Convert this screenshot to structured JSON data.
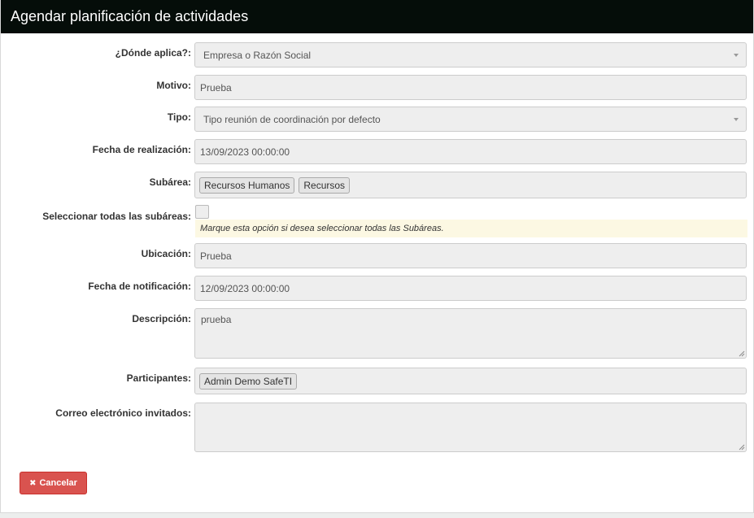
{
  "modal": {
    "title": "Agendar planificación de actividades"
  },
  "form": {
    "donde_aplica": {
      "label": "¿Dónde aplica?:",
      "value": "Empresa o Razón Social"
    },
    "motivo": {
      "label": "Motivo:",
      "value": "Prueba"
    },
    "tipo": {
      "label": "Tipo:",
      "value": "Tipo reunión de coordinación por defecto"
    },
    "fecha_realizacion": {
      "label": "Fecha de realización:",
      "value": "13/09/2023 00:00:00"
    },
    "subarea": {
      "label": "Subárea:",
      "tags": [
        "Recursos Humanos",
        "Recursos"
      ]
    },
    "seleccionar_todas": {
      "label": "Seleccionar todas las subáreas:",
      "help": "Marque esta opción si desea seleccionar todas las Subáreas.",
      "checked": false
    },
    "ubicacion": {
      "label": "Ubicación:",
      "value": "Prueba"
    },
    "fecha_notificacion": {
      "label": "Fecha de notificación:",
      "value": "12/09/2023 00:00:00"
    },
    "descripcion": {
      "label": "Descripción:",
      "value": "prueba"
    },
    "participantes": {
      "label": "Participantes:",
      "tags": [
        "Admin Demo SafeTI"
      ]
    },
    "correo_invitados": {
      "label": "Correo electrónico invitados:",
      "value": ""
    }
  },
  "actions": {
    "cancel_label": "Cancelar",
    "cancel_icon": "times-icon"
  },
  "colors": {
    "header_bg": "#050d09",
    "cancel_bg": "#d9534f",
    "help_bg": "#fcf8e3",
    "field_bg": "#eeeeee"
  }
}
